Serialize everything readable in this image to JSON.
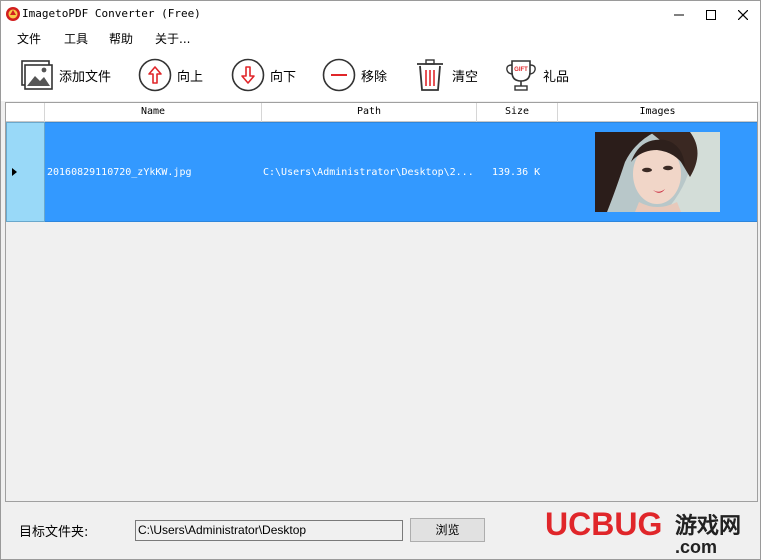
{
  "window": {
    "title": "ImagetoPDF Converter (Free)"
  },
  "menu": [
    {
      "label": "文件"
    },
    {
      "label": "工具"
    },
    {
      "label": "帮助"
    },
    {
      "label": "关于..."
    }
  ],
  "toolbar": [
    {
      "label": "添加文件",
      "icon": "add-image-icon"
    },
    {
      "label": "向上",
      "icon": "arrow-up-circle-icon"
    },
    {
      "label": "向下",
      "icon": "arrow-down-circle-icon"
    },
    {
      "label": "移除",
      "icon": "minus-circle-icon"
    },
    {
      "label": "清空",
      "icon": "trash-icon"
    },
    {
      "label": "礼品",
      "icon": "gift-trophy-icon",
      "badge": "GIFT"
    }
  ],
  "table": {
    "columns": [
      "Name",
      "Path",
      "Size",
      "Images"
    ],
    "rows": [
      {
        "name": "20160829110720_zYkKW.jpg",
        "path": "C:\\Users\\Administrator\\Desktop\\2...",
        "size": "139.36 K",
        "selected": true
      }
    ]
  },
  "footer": {
    "folder_label": "目标文件夹:",
    "folder_value": "C:\\Users\\Administrator\\Desktop",
    "browse_label": "浏览"
  },
  "watermark": {
    "text_main": "UCBUG",
    "text_cn": "游戏网",
    "text_dot": ".com"
  },
  "colors": {
    "selection": "#3399ff",
    "row_header": "#99d9f8",
    "icon_red": "#e0262a"
  }
}
